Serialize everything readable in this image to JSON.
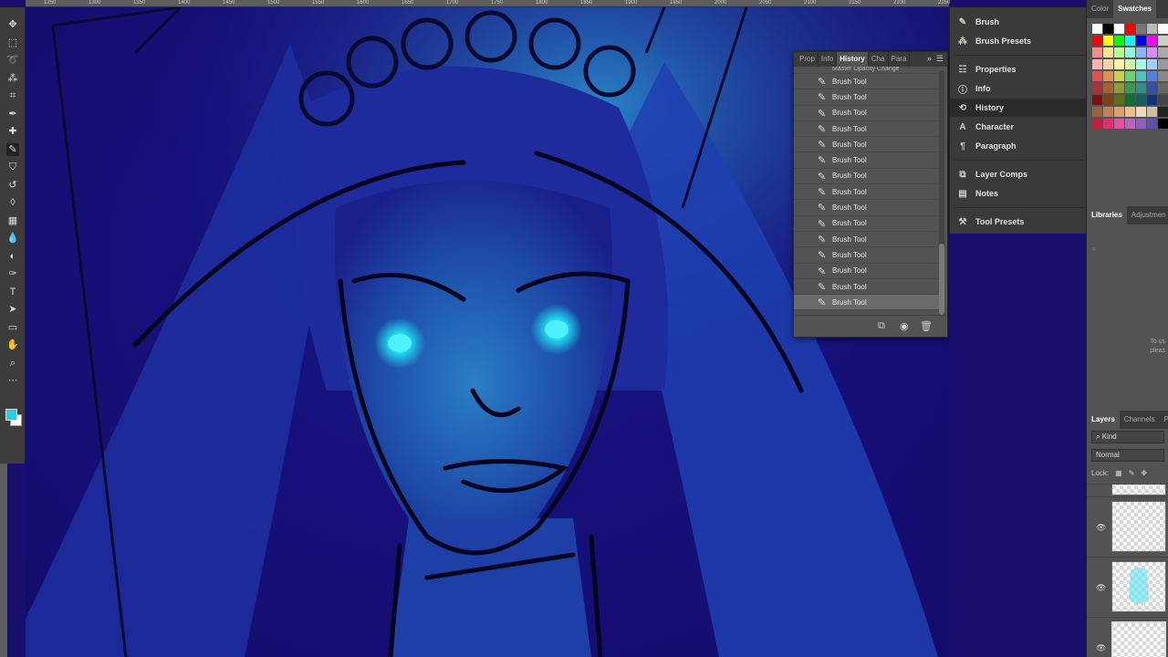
{
  "ruler": {
    "ticks": [
      "1250",
      "1300",
      "1350",
      "1400",
      "1450",
      "1500",
      "1550",
      "1600",
      "1650",
      "1700",
      "1750",
      "1800",
      "1850",
      "1900",
      "1950",
      "2000",
      "2050",
      "2100",
      "2150",
      "2200",
      "2250"
    ]
  },
  "colors": {
    "canvas_bg": "#17107a",
    "foreground": "#18d4e6",
    "background": "#ffffff",
    "panel": "#535353",
    "panel_dark": "#3a3a3a"
  },
  "toolbar": {
    "tools": [
      "move-icon",
      "marquee-icon",
      "lasso-icon",
      "magic-wand-icon",
      "crop-icon",
      "eyedropper-icon",
      "healing-icon",
      "brush-icon",
      "clone-stamp-icon",
      "history-brush-icon",
      "eraser-icon",
      "gradient-icon",
      "blur-icon",
      "dodge-icon",
      "pen-icon",
      "type-icon",
      "path-select-icon",
      "rectangle-icon",
      "hand-icon",
      "zoom-icon",
      "more-icon"
    ],
    "active_tool": "brush-icon"
  },
  "history_panel": {
    "tabs": [
      "Prop",
      "Info",
      "History",
      "Cha",
      "Para"
    ],
    "active_tab": "History",
    "first_item": "Master Opacity Change",
    "items": [
      "Brush Tool",
      "Brush Tool",
      "Brush Tool",
      "Brush Tool",
      "Brush Tool",
      "Brush Tool",
      "Brush Tool",
      "Brush Tool",
      "Brush Tool",
      "Brush Tool",
      "Brush Tool",
      "Brush Tool",
      "Brush Tool",
      "Brush Tool",
      "Brush Tool"
    ],
    "selected_index": 14
  },
  "dock": {
    "items": [
      {
        "label": "Brush",
        "icon": "brush-panel-icon"
      },
      {
        "label": "Brush Presets",
        "icon": "brush-presets-icon"
      },
      {
        "label": "Properties",
        "icon": "properties-icon"
      },
      {
        "label": "Info",
        "icon": "info-icon"
      },
      {
        "label": "History",
        "icon": "history-icon"
      },
      {
        "label": "Character",
        "icon": "character-icon"
      },
      {
        "label": "Paragraph",
        "icon": "paragraph-icon"
      },
      {
        "label": "Layer Comps",
        "icon": "layer-comps-icon"
      },
      {
        "label": "Notes",
        "icon": "notes-icon"
      },
      {
        "label": "Tool Presets",
        "icon": "tool-presets-icon"
      }
    ],
    "active": "History"
  },
  "swatches_panel": {
    "tabs": [
      "Color",
      "Swatches"
    ],
    "active_tab": "Swatches"
  },
  "libraries_panel": {
    "tabs": [
      "Libraries",
      "Adjustmen"
    ],
    "active_tab": "Libraries",
    "hint": "To us pleas"
  },
  "layers_panel": {
    "tabs": [
      "Layers",
      "Channels",
      "P"
    ],
    "active_tab": "Layers",
    "filter": "Kind",
    "blend_mode": "Normal",
    "lock_label": "Lock:"
  }
}
